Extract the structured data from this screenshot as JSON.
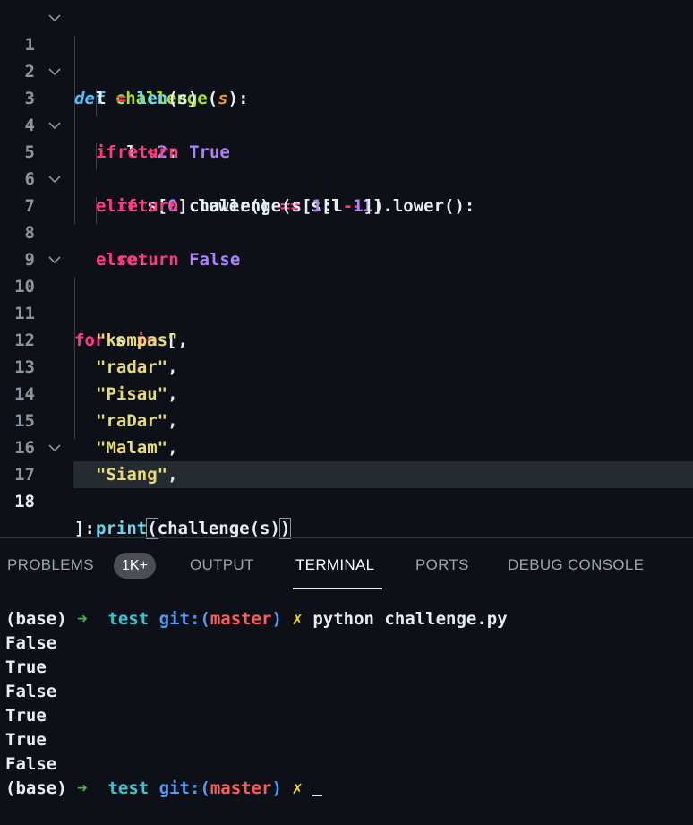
{
  "editor": {
    "line_numbers": [
      "1",
      "2",
      "3",
      "4",
      "5",
      "6",
      "7",
      "8",
      "9",
      "10",
      "11",
      "12",
      "13",
      "14",
      "15",
      "16",
      "17",
      "18"
    ],
    "tokens": {
      "l1_def": "def",
      "l1_name": "challenge",
      "l1_open": "(",
      "l1_param": "s",
      "l1_close": "):",
      "l2_a": "l ",
      "l2_eq": "=",
      "l2_sp": " ",
      "l2_len": "len",
      "l2_b": "(s)",
      "l3_if": "if",
      "l3_a": " l ",
      "l3_lt": "<",
      "l3_num": "2",
      "l3_b": ":",
      "l4_return": "return",
      "l4_sp": " ",
      "l4_true": "True",
      "l5_elif": "elif",
      "l5_a": " s[",
      "l5_zero": "0",
      "l5_b": "].lower() ",
      "l5_eqeq": "==",
      "l5_c": " s[l ",
      "l5_minus": "-",
      "l5_one": "1",
      "l5_d": "].lower():",
      "l6_return": "return",
      "l6_a": " challenge(s[",
      "l6_one": "1",
      "l6_b": ":l",
      "l6_minus": "-",
      "l6_one2": "1",
      "l6_c": "])",
      "l7_else": "else",
      "l7_a": ":",
      "l8_return": "return",
      "l8_sp": " ",
      "l8_false": "False",
      "l10_for": "for",
      "l10_a": " s ",
      "l10_in": "in",
      "l10_b": " [",
      "l17_a": "]:",
      "l18_print": "print",
      "l18_open": "(",
      "l18_mid": "challenge(s)",
      "l18_close": ")"
    },
    "strings": [
      "\"kompas\"",
      "\"radar\"",
      "\"Pisau\"",
      "\"raDar\"",
      "\"Malam\"",
      "\"Siang\""
    ],
    "comma": ","
  },
  "panel": {
    "tabs": [
      "PROBLEMS",
      "OUTPUT",
      "TERMINAL",
      "PORTS",
      "DEBUG CONSOLE"
    ],
    "problems_badge": "1K+",
    "active_tab": "TERMINAL"
  },
  "terminal": {
    "prompt_env": "(base)",
    "prompt_arrow": "➜",
    "prompt_dir": "test",
    "prompt_git": "git:(",
    "prompt_branch": "master",
    "prompt_git_close": ")",
    "prompt_cross": "✗",
    "command": "python challenge.py",
    "output": [
      "False",
      "True",
      "False",
      "True",
      "True",
      "False"
    ]
  },
  "colors": {
    "background": "#0d1117",
    "keyword": "#ff3b7f",
    "function": "#a6e22e",
    "string": "#e6db74",
    "constant": "#ae81ff",
    "builtin": "#66d9ef"
  }
}
